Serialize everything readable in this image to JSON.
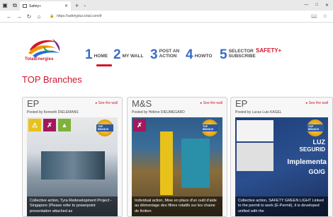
{
  "browser": {
    "tab_title": "Safety+",
    "url": "https://safetyplus.total.com/fr"
  },
  "brand": {
    "logo_text": "TotalEnergies"
  },
  "menu": [
    {
      "num": "1",
      "label": "HOME"
    },
    {
      "num": "2",
      "label": "MY WALL"
    },
    {
      "num": "3",
      "label": "POST AN ACTION"
    },
    {
      "num": "4",
      "label": "HOWTO"
    },
    {
      "num": "5",
      "label": "SELECTOR SUBSCRIBE"
    }
  ],
  "safety_label": "SAFETY+",
  "section_title": "TOP Branches",
  "cards": [
    {
      "title": "EP",
      "link": "▸ See the wall",
      "author": "Posted by Kenneth DIELEMANS",
      "badge": "TOP BRANCH",
      "caption": "Collective action, Tyra Redevelopment Project - Singapore (Please refer to powerpoint presentation attached as"
    },
    {
      "title": "M&S",
      "link": "▸ See the wall",
      "author": "Posted by Hélène DIEUMEGARD",
      "badge": "TOP BRANCH",
      "caption": "Individual action, Mise en place d'un outil d'aide au démontage des filtres rotatifs sur les chaine de finition"
    },
    {
      "title": "EP",
      "link": "▸ See the wall",
      "author": "Posted by Lucas Luis KAGEL",
      "badge": "TOP BRANCH",
      "caption": "Collective action, SAFETY GREEN LIGHT Linked to the permit to work (E-Permit), it is developed unified with the",
      "img_text_1": "Implementa",
      "img_text_2": "GO/G",
      "img_text_3": "LUZ",
      "img_text_4": "SEGURID"
    }
  ]
}
